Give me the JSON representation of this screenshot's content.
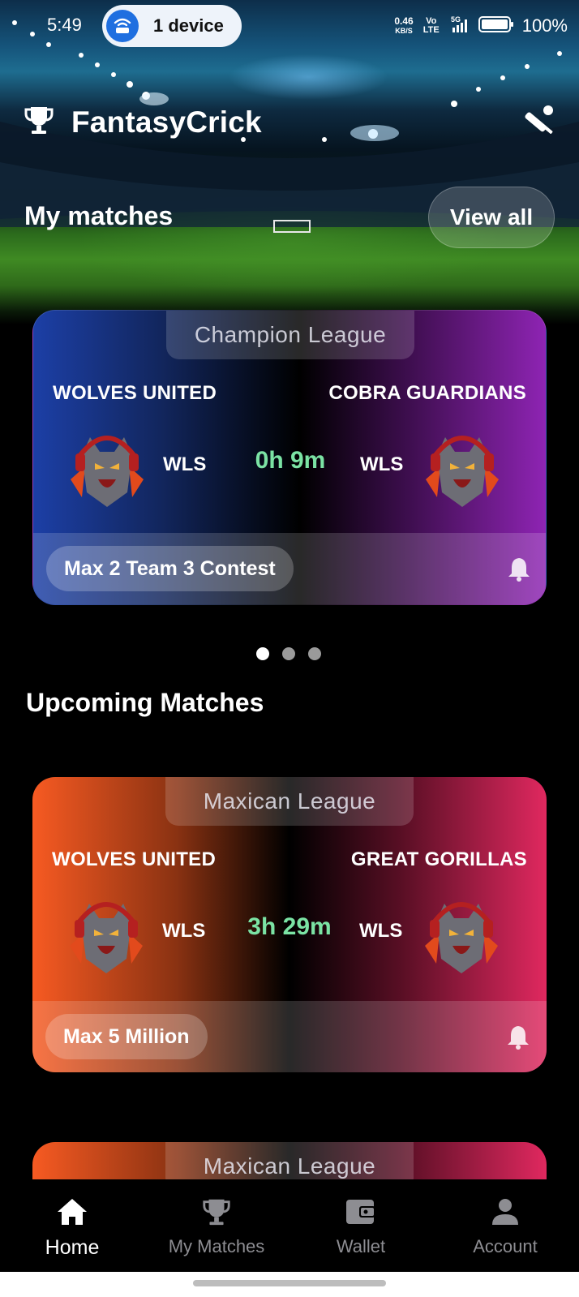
{
  "status_bar": {
    "time": "5:49",
    "device_pill": "1 device",
    "net_speed": "0.46",
    "net_unit": "KB/S",
    "volte": "Vo LTE",
    "network": "5G",
    "battery": "100%"
  },
  "header": {
    "app_title": "FantasyCrick",
    "logo_icon": "trophy-icon",
    "action_icon": "cricket-bat-ball-icon"
  },
  "my_matches": {
    "title": "My matches",
    "view_all": "View all",
    "card": {
      "league": "Champion League",
      "team_left": "WOLVES UNITED",
      "team_right": "COBRA GUARDIANS",
      "abbr_left": "WLS",
      "abbr_right": "WLS",
      "countdown": "0h 9m",
      "contest": "Max 2 Team 3 Contest"
    },
    "carousel": {
      "count": 3,
      "active": 0
    }
  },
  "upcoming": {
    "title": "Upcoming Matches",
    "cards": [
      {
        "league": "Maxican League",
        "team_left": "WOLVES UNITED",
        "team_right": "GREAT GORILLAS",
        "abbr_left": "WLS",
        "abbr_right": "WLS",
        "countdown": "3h 29m",
        "contest": "Max 5 Million"
      },
      {
        "league": "Maxican League"
      }
    ]
  },
  "bottom_nav": [
    {
      "label": "Home",
      "icon": "home-icon",
      "active": true
    },
    {
      "label": "My Matches",
      "icon": "trophy-icon",
      "active": false
    },
    {
      "label": "Wallet",
      "icon": "wallet-icon",
      "active": false
    },
    {
      "label": "Account",
      "icon": "account-icon",
      "active": false
    }
  ],
  "colors": {
    "countdown": "#7be3a4",
    "card_purple_left": "#1c3fa6",
    "card_purple_right": "#8e24b3",
    "card_orange_left": "#f75a22",
    "card_orange_right": "#e0285f"
  }
}
